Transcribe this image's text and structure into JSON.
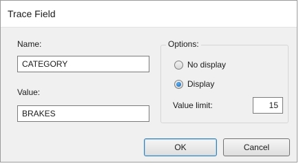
{
  "window": {
    "title": "Trace Field"
  },
  "name_field": {
    "label": "Name:",
    "value": "CATEGORY"
  },
  "value_field": {
    "label": "Value:",
    "value": "BRAKES"
  },
  "options": {
    "legend": "Options:",
    "no_display_label": "No display",
    "display_label": "Display",
    "selected": "Display",
    "value_limit_label": "Value limit:",
    "value_limit": "15"
  },
  "buttons": {
    "ok_label": "OK",
    "cancel_label": "Cancel"
  }
}
